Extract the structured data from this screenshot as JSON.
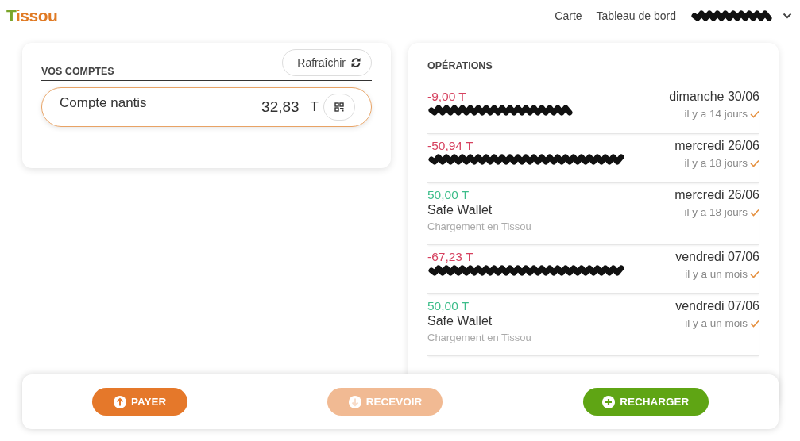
{
  "header": {
    "logo": "Tissou",
    "nav": [
      {
        "label": "Carte"
      },
      {
        "label": "Tableau de bord"
      }
    ],
    "user_menu": {
      "redacted": true
    }
  },
  "accounts": {
    "title": "VOS COMPTES",
    "refresh_label": "Rafraîchir",
    "items": [
      {
        "name": "Compte nantis",
        "balance": "32,83",
        "unit": "T"
      }
    ]
  },
  "operations": {
    "title": "OPÉRATIONS",
    "items": [
      {
        "kind": "debit",
        "amount": "-9,00 T",
        "redacted": true,
        "date": "dimanche 30/06",
        "ago": "il y a 14 jours",
        "confirmed": true
      },
      {
        "kind": "debit",
        "amount": "-50,94 T",
        "redacted": true,
        "date": "mercredi 26/06",
        "ago": "il y a 18 jours",
        "confirmed": true
      },
      {
        "kind": "credit",
        "amount": "50,00 T",
        "title": "Safe Wallet",
        "subtitle": "Chargement en Tissou",
        "date": "mercredi 26/06",
        "ago": "il y a 18 jours",
        "confirmed": true
      },
      {
        "kind": "debit",
        "amount": "-67,23 T",
        "redacted": true,
        "date": "vendredi 07/06",
        "ago": "il y a un mois",
        "confirmed": true
      },
      {
        "kind": "credit",
        "amount": "50,00 T",
        "title": "Safe Wallet",
        "subtitle": "Chargement en Tissou",
        "date": "vendredi 07/06",
        "ago": "il y a un mois",
        "confirmed": true
      }
    ]
  },
  "actions": [
    {
      "kind": "pay",
      "label": "PAYER",
      "disabled": false
    },
    {
      "kind": "receive",
      "label": "RECEVOIR",
      "disabled": true
    },
    {
      "kind": "topup",
      "label": "RECHARGER",
      "disabled": false
    }
  ]
}
